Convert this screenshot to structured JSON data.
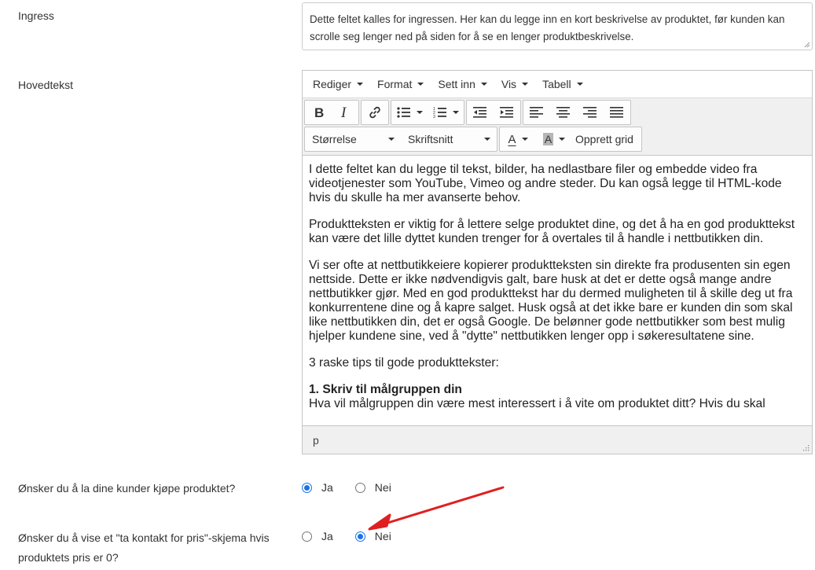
{
  "ingress": {
    "label": "Ingress",
    "text": "Dette feltet kalles for ingressen. Her kan du legge inn en kort beskrivelse av produktet, før kunden kan scrolle seg lenger ned på siden for å se en lenger produktbeskrivelse."
  },
  "hovedtekst": {
    "label": "Hovedtekst",
    "menu": [
      "Rediger",
      "Format",
      "Sett inn",
      "Vis",
      "Tabell"
    ],
    "toolbar": {
      "size_label": "Størrelse",
      "font_label": "Skriftsnitt",
      "grid_label": "Opprett grid",
      "font_color_letter": "A",
      "bg_color_letter": "A"
    },
    "paragraphs": [
      "I dette feltet kan du legge til tekst, bilder, ha nedlastbare filer og embedde video fra videotjenester som YouTube, Vimeo og andre steder. Du kan også legge til HTML-kode hvis du skulle ha mer avanserte behov.",
      "Produktteksten er viktig for å lettere selge produktet dine, og det å ha en god produkttekst kan være det lille dyttet kunden trenger for å overtales til å handle i nettbutikken din.",
      "Vi ser ofte at nettbutikkeiere kopierer produktteksten sin direkte fra produsenten sin egen nettside. Dette er ikke nødvendigvis galt, bare husk at det er dette også mange andre nettbutikker gjør. Med en god produkttekst har du dermed muligheten til å skille deg ut fra konkurrentene dine og å kapre salget. Husk også at det ikke bare er kunden din som skal like nettbutikken din, det er også Google. De belønner gode nettbutikker som best mulig hjelper kundene sine, ved å \"dytte\" nettbutikken lenger opp i søkeresultatene sine.",
      "3 raske tips til gode produkttekster:"
    ],
    "tip_heading": "1. Skriv til målgruppen din",
    "tip_text": "Hva vil målgruppen din være mest interessert i å vite om produktet ditt? Hvis du skal",
    "status_path": "p"
  },
  "buy_question": {
    "label": "Ønsker du å la dine kunder kjøpe produktet?",
    "options": [
      "Ja",
      "Nei"
    ],
    "selected": "Ja"
  },
  "contact_question": {
    "label_line1": "Ønsker du å vise et \"ta kontakt for pris\"-skjema hvis",
    "label_line2": "produktets pris er 0?",
    "options": [
      "Ja",
      "Nei"
    ],
    "selected": "Nei"
  },
  "colors": {
    "accent": "#1a73e8",
    "arrow": "#e02020",
    "border": "#c5c5c5",
    "toolbar_bg": "#f0f0f0"
  }
}
